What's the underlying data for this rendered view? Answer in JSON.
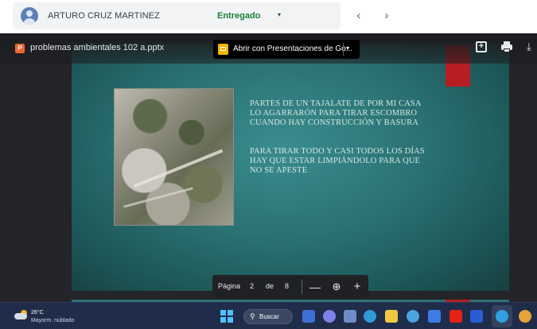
{
  "classroom": {
    "student_name": "ARTURO CRUZ MARTINEZ",
    "status": "Entregado",
    "status_caret": "▾",
    "prev": "‹",
    "next": "›"
  },
  "viewer": {
    "file_icon_letter": "P",
    "file_name": "problemas ambientales 102 a.pptx",
    "open_with_label": "Abrir con Presentaciones de Go...",
    "open_caret": "▾",
    "add_icon_glyph": "+",
    "download_icon_glyph": "⤓"
  },
  "slide": {
    "paragraph_1": "PARTES DE UN TAJALATE DE POR MI CASA LO AGARRARÓN PARA TIRAR ESCOMBRO CUANDO HAY CONSTRUCCIÓN Y BASURA",
    "paragraph_2": "PARA TIRAR TODO Y CASI TODOS LOS DÍAS HAY QUE ESTAR LIMPIÁNDOLO PARA QUE NO SE APESTE"
  },
  "page_nav": {
    "label": "Página",
    "current": "2",
    "of": "de",
    "total": "8",
    "zoom_out": "—",
    "zoom_icon": "⊕",
    "zoom_in": "+"
  },
  "taskbar": {
    "temperature": "26°C",
    "condition": "Mayorm. nublado",
    "search_label": "Buscar",
    "search_glyph": "⚲"
  },
  "colors": {
    "status_green": "#188038",
    "slide_teal": "#2a7173",
    "slide_red": "#b61e22",
    "taskbar_bg": "#1f2d4a"
  }
}
